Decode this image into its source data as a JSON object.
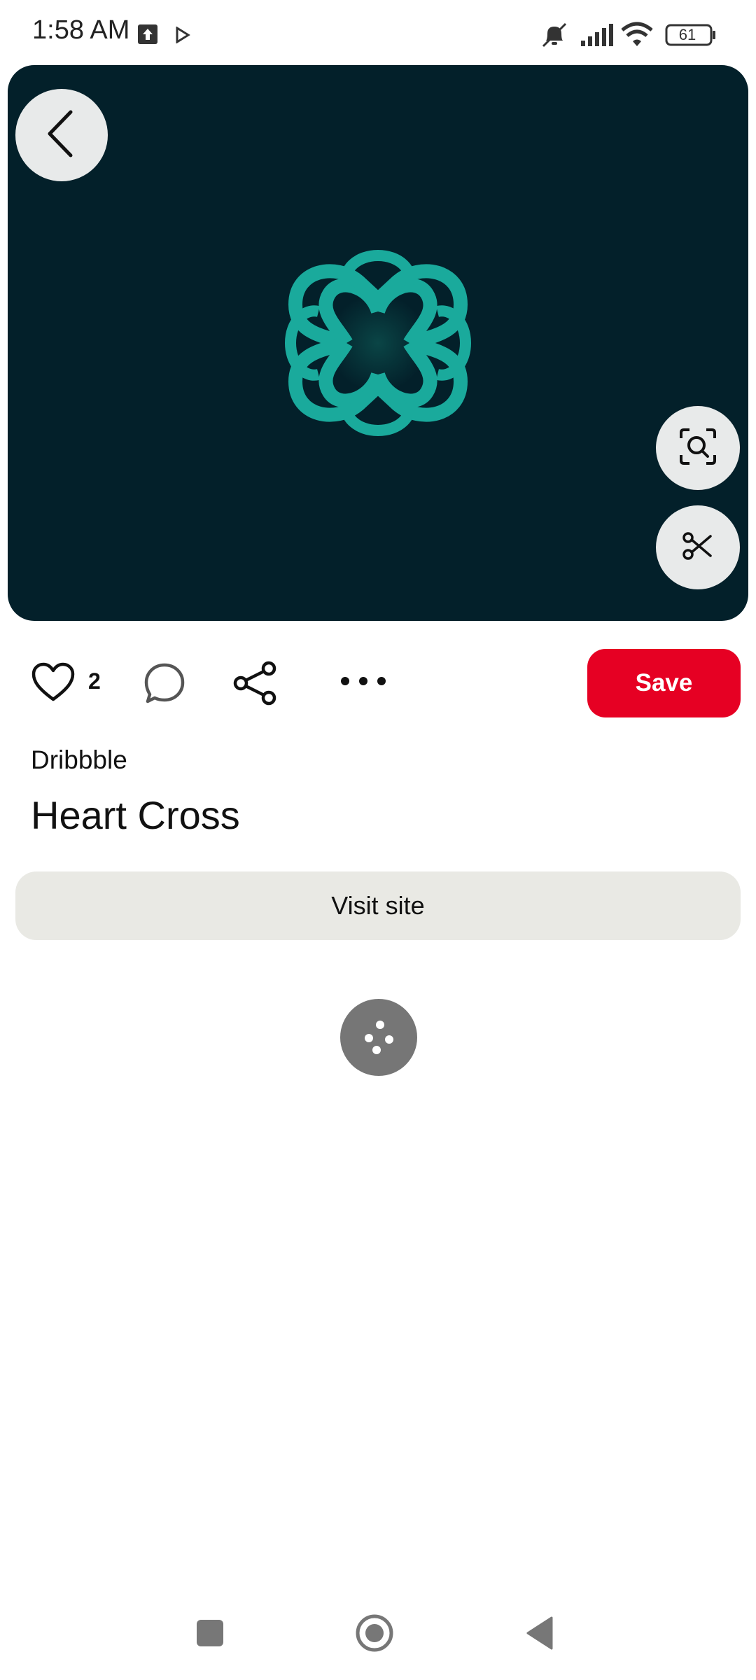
{
  "status_bar": {
    "time": "1:58 AM",
    "battery": "61",
    "icons": [
      "upload-notification-icon",
      "play-store-icon",
      "mute-icon",
      "signal-icon",
      "wifi-icon",
      "battery-icon"
    ]
  },
  "pin": {
    "source": "Dribbble",
    "title": "Heart Cross",
    "like_count": "2",
    "save_label": "Save",
    "visit_label": "Visit site"
  },
  "colors": {
    "save": "#e60023",
    "hero_bg": "#03202a",
    "logo": "#1aaa9c",
    "visit_bg": "#e9e9e4"
  },
  "icons": {
    "back": "back-arrow-icon",
    "lens": "visual-search-icon",
    "crop": "scissors-icon",
    "like": "heart-icon",
    "comment": "comment-icon",
    "share": "share-icon",
    "more": "more-icon",
    "loader": "loading-dots-icon"
  }
}
